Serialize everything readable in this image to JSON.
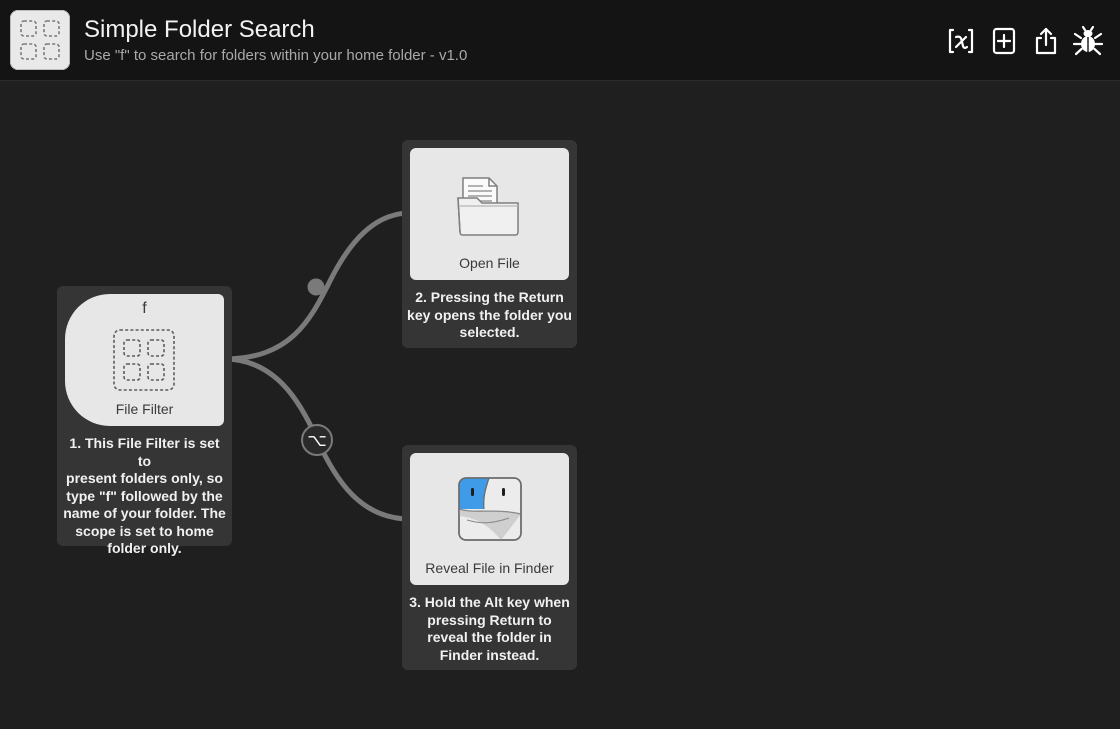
{
  "header": {
    "title": "Simple Folder Search",
    "subtitle": "Use \"f\" to search for folders within your home folder - v1.0",
    "app_icon": "dashed-folder-grid-icon",
    "toolbar": [
      {
        "name": "variables-icon"
      },
      {
        "name": "add-object-icon"
      },
      {
        "name": "share-icon"
      },
      {
        "name": "debug-bug-icon"
      }
    ]
  },
  "workflow": {
    "file_filter": {
      "keyword": "f",
      "label": "File Filter",
      "note": [
        "1. This File Filter is set to",
        "present folders only, so",
        "type \"f\" followed by the",
        "name of your folder. The",
        "scope is set to home",
        "folder only."
      ]
    },
    "open_file": {
      "label": "Open File",
      "note": [
        "2. Pressing the Return",
        "key opens the folder you",
        "selected."
      ]
    },
    "reveal_file": {
      "label": "Reveal File in Finder",
      "note": [
        "3. Hold the Alt key when",
        "pressing Return to",
        "reveal the folder in",
        "Finder instead."
      ]
    },
    "modifier_symbol": "⌥"
  },
  "colors": {
    "background": "#1f1f1f",
    "header": "#141414",
    "node": "#353535",
    "card": "#e7e7e7",
    "connector": "#7a7a7a",
    "finder_blue": "#3f9ae8"
  }
}
